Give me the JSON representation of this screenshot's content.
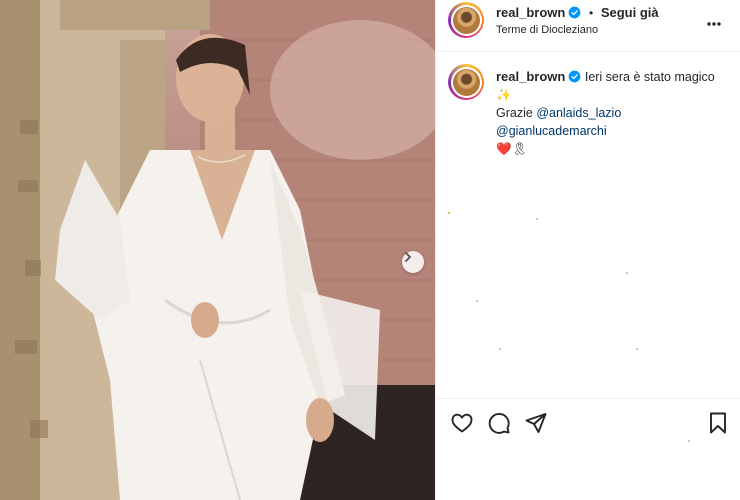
{
  "post": {
    "username": "real_brown",
    "follow_status": "Segui già",
    "separator": "•",
    "location": "Terme di Diocleziano",
    "caption_text": "Ieri sera è stato magico",
    "caption_emoji": "✨",
    "thanks_prefix": "Grazie",
    "mention_1": "@anlaids_lazio",
    "mention_2": "@gianlucademarchi",
    "caption_emoji_end": "❤️🎗"
  },
  "icons": {
    "verified": "verified-badge-icon",
    "more": "more-options-icon",
    "next": "chevron-right-icon",
    "like": "heart-icon",
    "comment": "comment-icon",
    "share": "send-icon",
    "save": "bookmark-icon"
  },
  "colors": {
    "verified": "#0095f6",
    "mention": "#00376b",
    "heart": "#ed4956"
  }
}
